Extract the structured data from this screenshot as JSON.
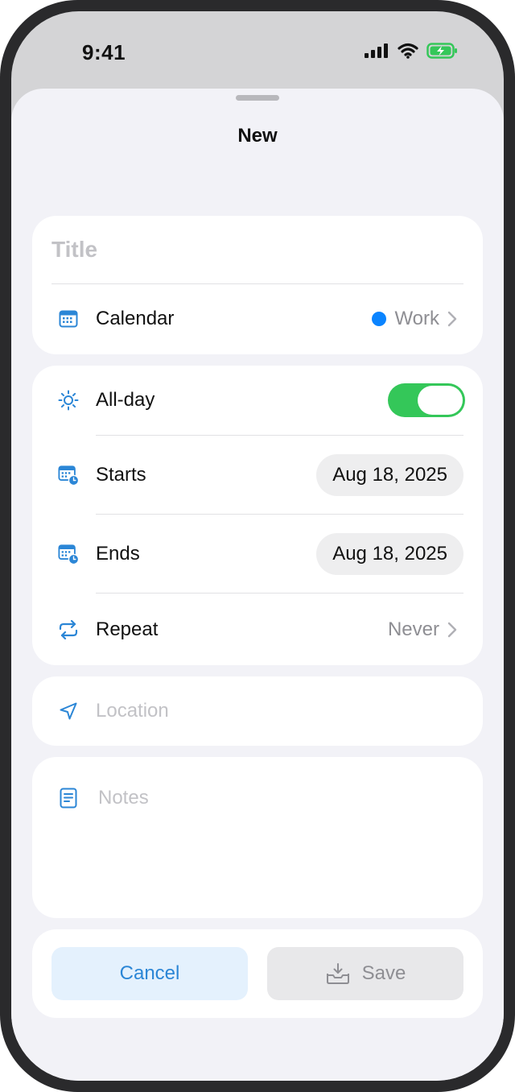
{
  "status_bar": {
    "time": "9:41"
  },
  "sheet": {
    "title": "New"
  },
  "form": {
    "title_placeholder": "Title",
    "calendar": {
      "label": "Calendar",
      "value": "Work",
      "dot_color": "#0a84ff"
    },
    "all_day": {
      "label": "All-day",
      "on": true
    },
    "starts": {
      "label": "Starts",
      "value": "Aug 18, 2025"
    },
    "ends": {
      "label": "Ends",
      "value": "Aug 18, 2025"
    },
    "repeat": {
      "label": "Repeat",
      "value": "Never"
    },
    "location_placeholder": "Location",
    "notes_placeholder": "Notes"
  },
  "actions": {
    "cancel": "Cancel",
    "save": "Save"
  },
  "colors": {
    "accent": "#2b86d6",
    "toggle_on": "#34c759",
    "battery": "#34c759"
  },
  "icons": [
    "signal-icon",
    "wifi-icon",
    "battery-charging-icon",
    "calendar-icon",
    "sun-icon",
    "calendar-clock-icon",
    "repeat-icon",
    "location-arrow-icon",
    "notes-icon",
    "chevron-right-icon",
    "tray-download-icon"
  ]
}
